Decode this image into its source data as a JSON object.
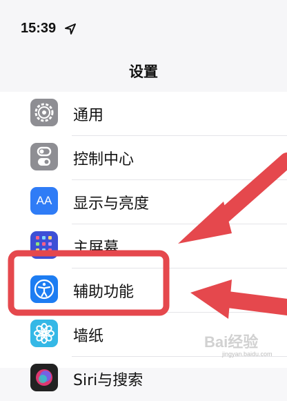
{
  "status_bar": {
    "time": "15:39",
    "location_icon": "location-arrow-icon"
  },
  "header": {
    "title": "设置"
  },
  "settings": {
    "items": [
      {
        "label": "通用",
        "icon": "gear-icon",
        "icon_bg": "#8e8e93"
      },
      {
        "label": "控制中心",
        "icon": "toggle-icon",
        "icon_bg": "#8e8e93"
      },
      {
        "label": "显示与亮度",
        "icon": "aa-icon",
        "icon_text": "AA",
        "icon_bg": "#2f7cf6"
      },
      {
        "label": "主屏幕",
        "icon": "home-grid-icon",
        "icon_bg": "#3d4fd6"
      },
      {
        "label": "辅助功能",
        "icon": "accessibility-icon",
        "icon_bg": "#1d7df2"
      },
      {
        "label": "墙纸",
        "icon": "flower-icon",
        "icon_bg": "#35b8e6"
      },
      {
        "label": "Siri与搜索",
        "icon": "siri-icon",
        "icon_bg": "#222222"
      }
    ]
  },
  "annotation": {
    "highlight_color": "#e5484d",
    "arrow_color": "#e5484d"
  },
  "watermark": {
    "brand": "Bai经验",
    "url": "jingyan.baidu.com"
  }
}
